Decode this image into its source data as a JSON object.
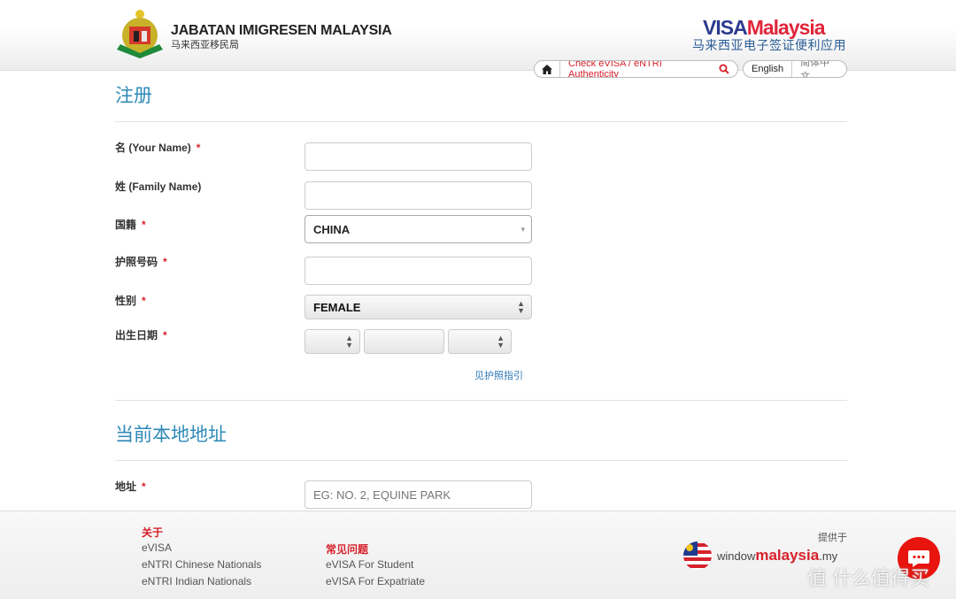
{
  "header": {
    "agency_name": "JABATAN IMIGRESEN MALAYSIA",
    "agency_name_cn": "马来西亚移民局",
    "brand_visa": "VISA",
    "brand_malaysia": "Malaysia",
    "brand_subtitle": "马来西亚电子签证便利应用",
    "nav": {
      "home_icon": "home-icon",
      "check_label": "Check eVISA / eNTRI Authenticity",
      "search_icon": "search-icon",
      "lang_en": "English",
      "lang_cn": "简体中文"
    }
  },
  "form": {
    "section1_title": "注册",
    "fields": [
      {
        "label": "名 (Your Name)",
        "required": true,
        "value": ""
      },
      {
        "label": "姓 (Family Name)",
        "required": false,
        "value": ""
      },
      {
        "label": "国籍",
        "required": true,
        "value": "CHINA"
      },
      {
        "label": "护照号码",
        "required": true,
        "value": ""
      },
      {
        "label": "性别",
        "required": true,
        "value": "FEMALE"
      },
      {
        "label": "出生日期",
        "required": true,
        "value": ""
      }
    ],
    "required_mark": "*",
    "passport_guide_link": "见护照指引",
    "section2_title": "当前本地地址",
    "address_label": "地址",
    "address_placeholder": "EG: NO. 2, EQUINE PARK"
  },
  "footer": {
    "about_heading": "关于",
    "about_links": [
      "eVISA",
      "eNTRI Chinese Nationals",
      "eNTRI Indian Nationals"
    ],
    "faq_heading": "常见问题",
    "faq_links": [
      "eVISA For Student",
      "eVISA For Expatriate"
    ],
    "provided_by": "提供于",
    "partner_window": "window",
    "partner_malaysia": "malaysia",
    "partner_my": ".my"
  },
  "watermark": "值 什么值得买",
  "colors": {
    "accent": "#2e8ab8",
    "required": "#d6212b",
    "chat": "#e8140e"
  }
}
